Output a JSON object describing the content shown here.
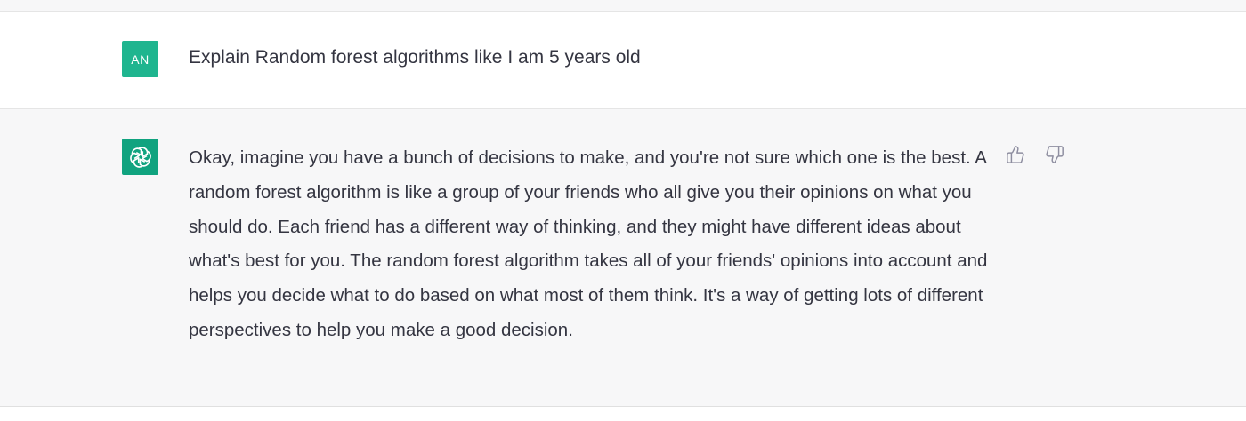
{
  "user_message": {
    "avatar_initials": "AN",
    "text": "Explain Random forest algorithms like I am 5 years old"
  },
  "assistant_message": {
    "avatar_icon": "openai-logo-icon",
    "text": "Okay, imagine you have a bunch of decisions to make, and you're not sure which one is the best. A random forest algorithm is like a group of your friends who all give you their opinions on what you should do. Each friend has a different way of thinking, and they might have different ideas about what's best for you. The random forest algorithm takes all of your friends' opinions into account and helps you decide what to do based on what most of them think. It's a way of getting lots of different perspectives to help you make a good decision.",
    "feedback": {
      "thumbs_up_icon": "thumbs-up-icon",
      "thumbs_down_icon": "thumbs-down-icon"
    }
  },
  "colors": {
    "user_avatar": "#1fb58f",
    "assistant_avatar": "#10a37f",
    "text": "#343541",
    "assistant_background": "#f7f7f8",
    "user_background": "#ffffff"
  }
}
